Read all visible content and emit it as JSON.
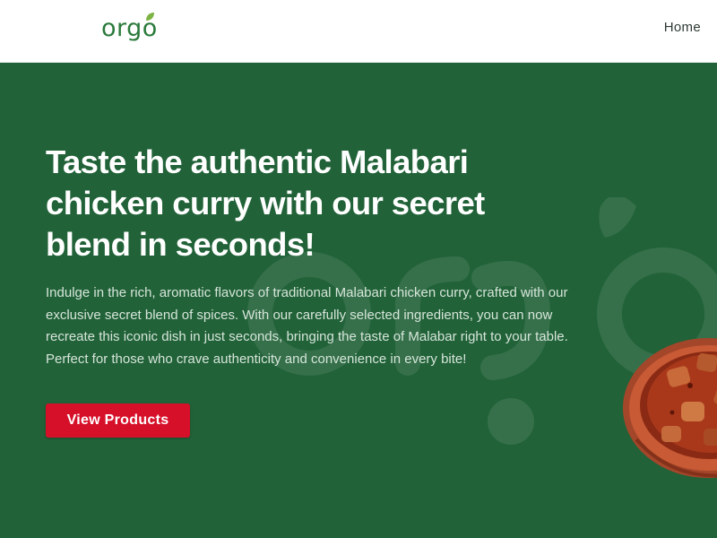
{
  "header": {
    "logo_text": "orgo",
    "nav": {
      "home_label": "Home"
    }
  },
  "hero": {
    "title": "Taste the authentic Malabari chicken curry with our secret blend in seconds!",
    "description": "Indulge in the rich, aromatic flavors of traditional Malabari chicken curry, crafted with our exclusive secret blend of spices. With our carefully selected ingredients, you can now recreate this iconic dish in just seconds, bringing the taste of Malabar right to your table. Perfect for those who crave authenticity and convenience in every bite!",
    "cta_label": "View Products"
  },
  "colors": {
    "brand_green": "#216238",
    "logo_green": "#2a7a3b",
    "cta_red": "#d7102a"
  },
  "icons": {
    "logo_leaf": "leaf-icon",
    "background": "orgo-watermark",
    "food_image": "curry-bowl-image"
  }
}
